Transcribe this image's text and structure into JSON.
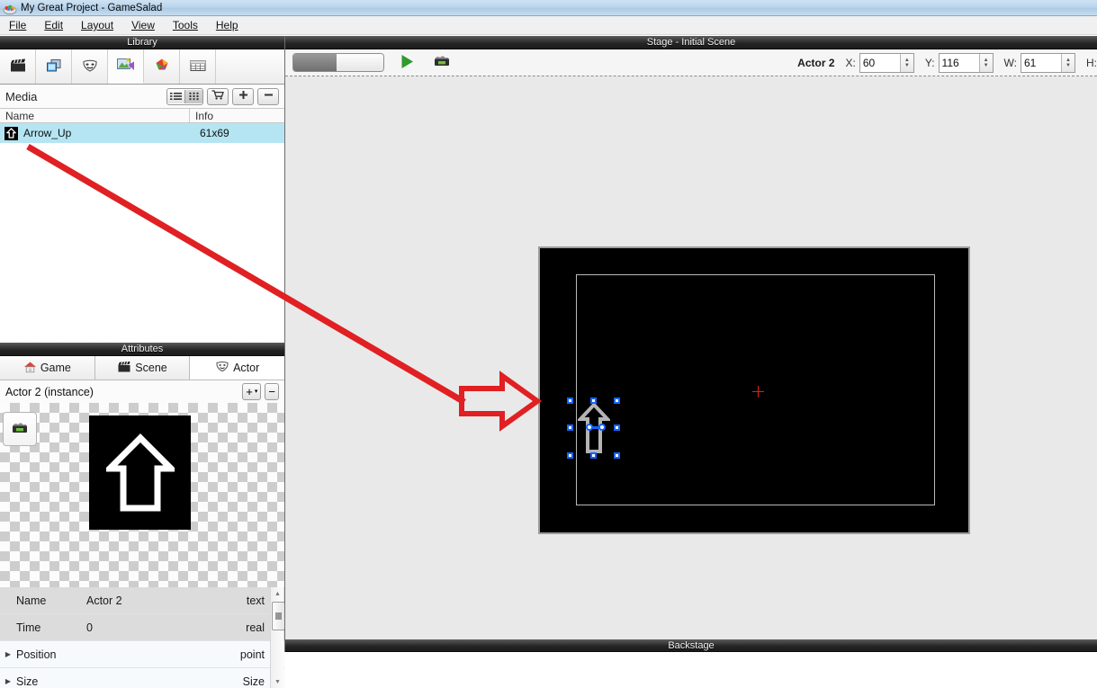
{
  "window": {
    "title": "My Great Project - GameSalad",
    "icon": "gamesalad-logo-icon"
  },
  "menubar": {
    "items": [
      {
        "label": "File",
        "accel": "F"
      },
      {
        "label": "Edit",
        "accel": "E"
      },
      {
        "label": "Layout",
        "accel": "L"
      },
      {
        "label": "View",
        "accel": "V"
      },
      {
        "label": "Tools",
        "accel": "T"
      },
      {
        "label": "Help",
        "accel": "H"
      }
    ]
  },
  "library": {
    "header": "Library",
    "tabs": [
      {
        "name": "scenes-tab",
        "icon": "clapperboard-icon",
        "active": false
      },
      {
        "name": "actors-tab",
        "icon": "layers-icon",
        "active": false
      },
      {
        "name": "behaviors-tab",
        "icon": "mask-icon",
        "active": false
      },
      {
        "name": "images-tab",
        "icon": "media-image-icon",
        "active": true
      },
      {
        "name": "colors-tab",
        "icon": "color-palette-icon",
        "active": false
      },
      {
        "name": "tables-tab",
        "icon": "table-grid-icon",
        "active": false
      }
    ],
    "media_title": "Media",
    "view_toggle": {
      "list": "list-view-icon",
      "grid": "grid-view-icon",
      "selected": "grid"
    },
    "buttons": [
      {
        "name": "marketplace-button",
        "icon": "shopping-cart-icon"
      },
      {
        "name": "add-media-button",
        "icon": "plus-icon"
      },
      {
        "name": "remove-media-button",
        "icon": "minus-icon"
      }
    ],
    "columns": [
      "Name",
      "Info"
    ],
    "rows": [
      {
        "name": "Arrow_Up",
        "info": "61x69",
        "icon": "arrow-up-thumbnail",
        "selected": true
      }
    ]
  },
  "attributes": {
    "header": "Attributes",
    "tabs": [
      {
        "label": "Game",
        "icon": "house-icon",
        "active": false
      },
      {
        "label": "Scene",
        "icon": "clapperboard-icon",
        "active": false
      },
      {
        "label": "Actor",
        "icon": "mask-icon",
        "active": true
      }
    ],
    "instance_label": "Actor 2 (instance)",
    "add_button": "+",
    "add_dropdown": "▾",
    "remove_button": "−",
    "preview": {
      "camera_button": "camera-icon",
      "image": "arrow-up-white-on-black"
    },
    "table": {
      "rows": [
        {
          "key": "Name",
          "value": "Actor 2",
          "type": "text",
          "expandable": false
        },
        {
          "key": "Time",
          "value": "0",
          "type": "real",
          "expandable": false
        },
        {
          "key": "Position",
          "value": "",
          "type": "point",
          "expandable": true
        },
        {
          "key": "Size",
          "value": "",
          "type": "Size",
          "expandable": true
        }
      ]
    },
    "scrollbar": {
      "up": "▲",
      "down": "▼"
    }
  },
  "stage": {
    "header": "Stage - Initial Scene",
    "toolbar": {
      "preview_toggle": "preview-edit-toggle",
      "play_button": "play-icon",
      "publish_button": "publish-camera-icon"
    },
    "selection": {
      "actor_name": "Actor 2",
      "fields": [
        {
          "label": "X:",
          "value": "60"
        },
        {
          "label": "Y:",
          "value": "116"
        },
        {
          "label": "W:",
          "value": "61"
        },
        {
          "label": "H:",
          "value": ""
        }
      ]
    },
    "canvas": {
      "actor_icon": "arrow-up-outline",
      "origin_marker": "red-crosshair"
    },
    "backstage": "Backstage"
  },
  "annotation": {
    "line_color": "#e02022",
    "arrow_color": "#e02022",
    "description": "red-pointer-arrow"
  },
  "colors": {
    "selection_row": "#b5e5f2",
    "handle_blue": "#1464ff",
    "annotation_red": "#e02022",
    "panel_dark": "#2b2b2b",
    "titlebar_blue": "#b9d4ec"
  }
}
